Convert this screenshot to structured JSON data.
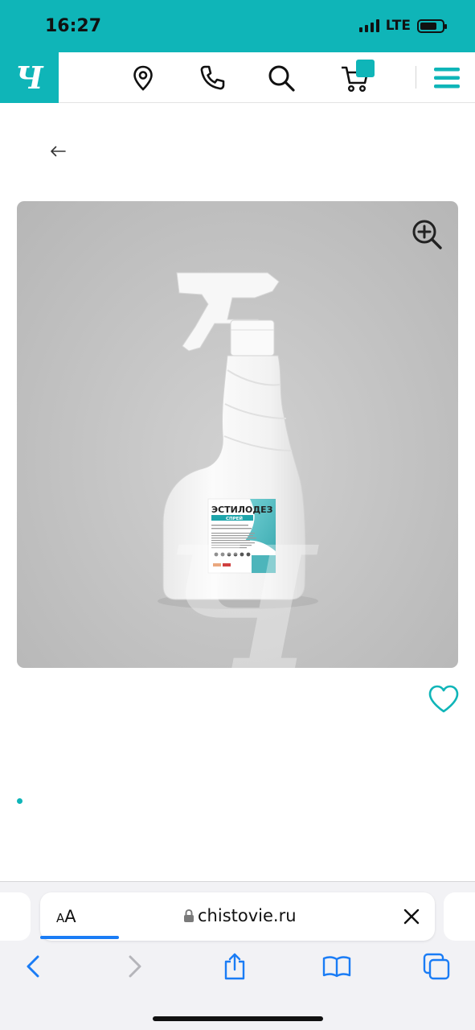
{
  "status_bar": {
    "time": "16:27",
    "network": "LTE",
    "battery_level": 0.75,
    "background_color": "#0fb5b8"
  },
  "header": {
    "logo_text": "Ч",
    "icons": [
      "map-pin-icon",
      "phone-icon",
      "search-icon",
      "cart-icon",
      "menu-icon"
    ],
    "accent_color": "#0fb5b8"
  },
  "product": {
    "label_title": "ЭСТИЛОДЕЗ",
    "label_subtitle": "СПРЕЙ",
    "watermark": "Ч"
  },
  "browser": {
    "text_size_small": "A",
    "text_size_big": "A",
    "url": "chistovie.ru",
    "load_progress": 0.2,
    "toolbar_icons": [
      "back-icon",
      "forward-icon",
      "share-icon",
      "bookmarks-icon",
      "tabs-icon"
    ]
  }
}
